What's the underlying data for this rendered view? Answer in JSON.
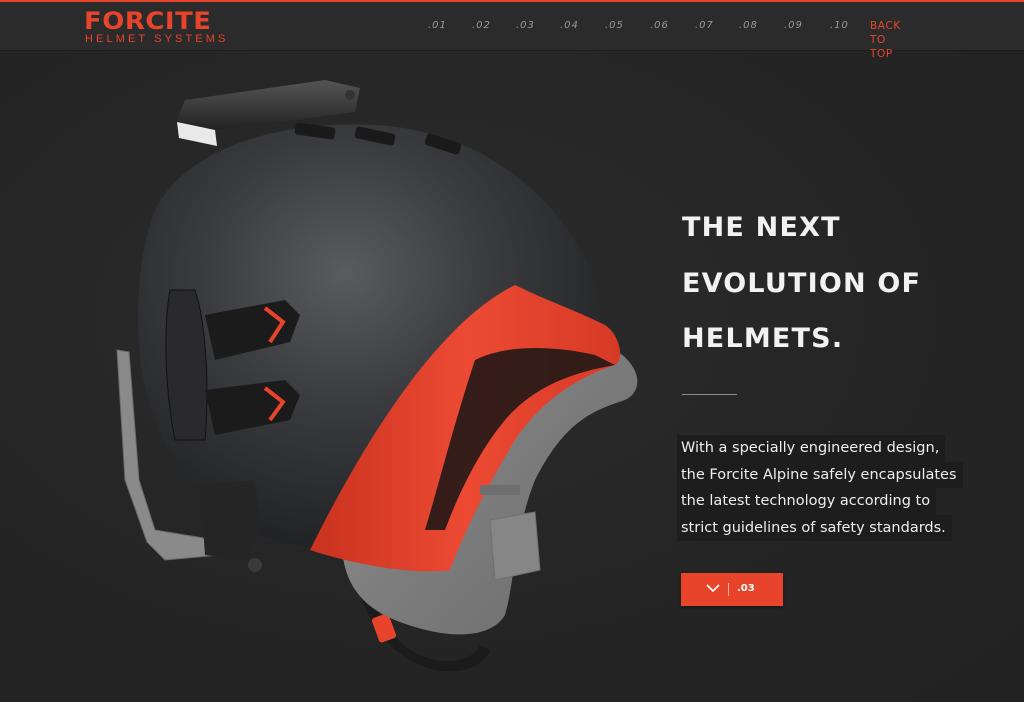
{
  "header": {
    "logo_main": "FORCITE",
    "logo_sub": "HELMET SYSTEMS",
    "nav": [
      ".01",
      ".02",
      ".03",
      ".04",
      ".05",
      ".06",
      ".07",
      ".08",
      ".09",
      ".10"
    ],
    "back_to_top": "BACK TO TOP"
  },
  "hero": {
    "headline": [
      "THE NEXT",
      "EVOLUTION OF",
      "HELMETS."
    ],
    "body": [
      "With a specially engineered design,",
      "the Forcite Alpine safely encapsulates",
      "the latest technology according to",
      "strict guidelines of safety standards."
    ],
    "cta_label": ".03",
    "cta_icon": "chevron-down-icon"
  },
  "colors": {
    "accent": "#e8442c",
    "background": "#262626",
    "header": "#2b2b2b",
    "text": "#f2f2f2"
  }
}
